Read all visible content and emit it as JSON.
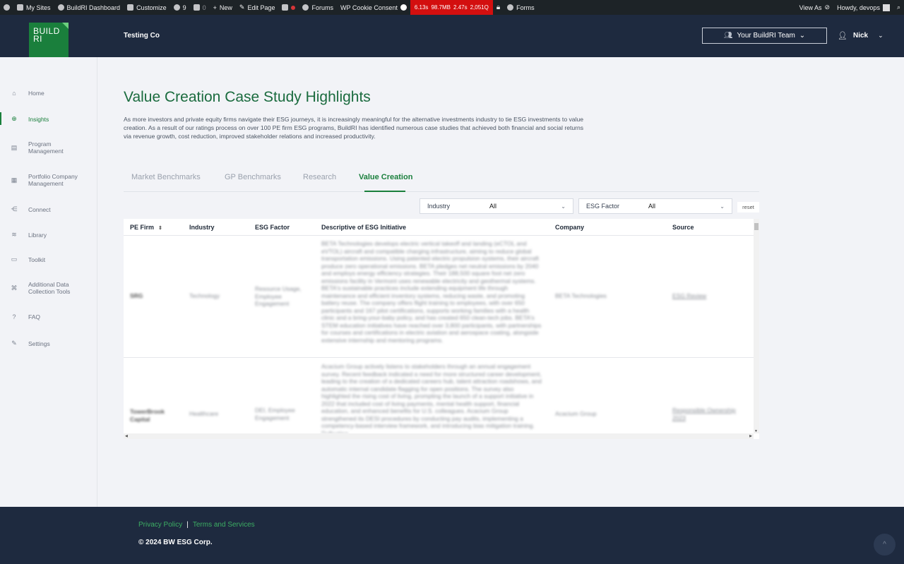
{
  "adminbar": {
    "my_sites": "My Sites",
    "dashboard": "BuildRI Dashboard",
    "customize": "Customize",
    "updates": "9",
    "comments": "0",
    "new": "New",
    "edit_page": "Edit Page",
    "forums": "Forums",
    "cookie": "WP Cookie Consent",
    "qm": [
      "6.13s",
      "98.7MB",
      "2.47s",
      "2,051Q"
    ],
    "forms": "Forms",
    "view_as": "View As",
    "howdy": "Howdy, devops"
  },
  "header": {
    "logo": [
      "BUILD",
      "RI"
    ],
    "company": "Testing Co",
    "team_button": "Your BuildRI Team",
    "user": "Nick"
  },
  "sidebar": {
    "items": [
      {
        "label": "Home",
        "icon": "home-icon"
      },
      {
        "label": "Insights",
        "icon": "globe-icon"
      },
      {
        "label": "Program Management",
        "icon": "program-icon"
      },
      {
        "label": "Portfolio Company Management",
        "icon": "portfolio-icon"
      },
      {
        "label": "Connect",
        "icon": "connect-icon"
      },
      {
        "label": "Library",
        "icon": "library-icon"
      },
      {
        "label": "Toolkit",
        "icon": "toolkit-icon"
      },
      {
        "label": "Additional Data Collection Tools",
        "icon": "command-icon"
      },
      {
        "label": "FAQ",
        "icon": "faq-icon"
      },
      {
        "label": "Settings",
        "icon": "wrench-icon"
      }
    ]
  },
  "main": {
    "title": "Value Creation Case Study Highlights",
    "intro": "As more investors and private equity firms navigate their ESG journeys, it is increasingly meaningful for the alternative investments industry to tie ESG investments to value creation. As a result of our ratings process on over 100 PE firm ESG programs, BuildRI has identified numerous case studies that achieved both financial and social returns via revenue growth, cost reduction, improved stakeholder relations and increased productivity.",
    "tabs": [
      "Market Benchmarks",
      "GP Benchmarks",
      "Research",
      "Value Creation"
    ],
    "filters": {
      "industry_label": "Industry",
      "industry_value": "All",
      "esg_label": "ESG Factor",
      "esg_value": "All",
      "reset": "reset"
    },
    "table": {
      "headers": [
        "PE Firm",
        "Industry",
        "ESG Factor",
        "Descriptive of ESG Initiative",
        "Company",
        "Source"
      ],
      "rows": [
        {
          "firm": "SRG",
          "industry": "Technology",
          "esg": "Resource Usage, Employee Engagement",
          "desc": "BETA Technologies develops electric vertical takeoff and landing (eCTOL and eVTOL) aircraft and compatible charging infrastructure, aiming to reduce global transportation emissions. Using patented electric propulsion systems, their aircraft produce zero operational emissions. BETA pledges net neutral emissions by 2040 and employs energy efficiency strategies. Their 188,500 square foot net zero emissions facility in Vermont uses renewable electricity and geothermal systems. BETA's sustainable practices include extending equipment life through maintenance and efficient inventory systems, reducing waste, and promoting battery reuse. The company offers flight training to employees, with over 650 participants and 167 pilot certifications, supports working families with a health clinic and a bring-your-baby policy, and has created 650 clean-tech jobs. BETA's STEM education initiatives have reached over 3,800 participants, with partnerships for courses and certifications in electric aviation and aerospace coating, alongside extensive internship and mentoring programs.",
          "company": "BETA Technologies",
          "source": "ESG Review"
        },
        {
          "firm": "TowerBrook Capital",
          "industry": "Healthcare",
          "esg": "DEI, Employee Engagement",
          "desc": "Acacium Group actively listens to stakeholders through an annual engagement survey. Recent feedback indicated a need for more structured career development, leading to the creation of a dedicated careers hub, talent attraction roadshows, and automatic internal candidate flagging for open positions. The survey also highlighted the rising cost of living, prompting the launch of a support initiative in 2022 that included cost of living payments, mental health support, financial education, and enhanced benefits for U.S. colleagues. Acacium Group strengthened its DESI procedures by conducting pay audits, implementing a competency-based interview framework, and introducing bias mitigation training. Reflecting",
          "company": "Acacium Group",
          "source": "Responsible Ownership 2023"
        }
      ]
    }
  },
  "footer": {
    "privacy": "Privacy Policy",
    "separator": "|",
    "terms": "Terms and Services",
    "copyright": "© 2024 BW ESG Corp.",
    "to_top": "^"
  }
}
